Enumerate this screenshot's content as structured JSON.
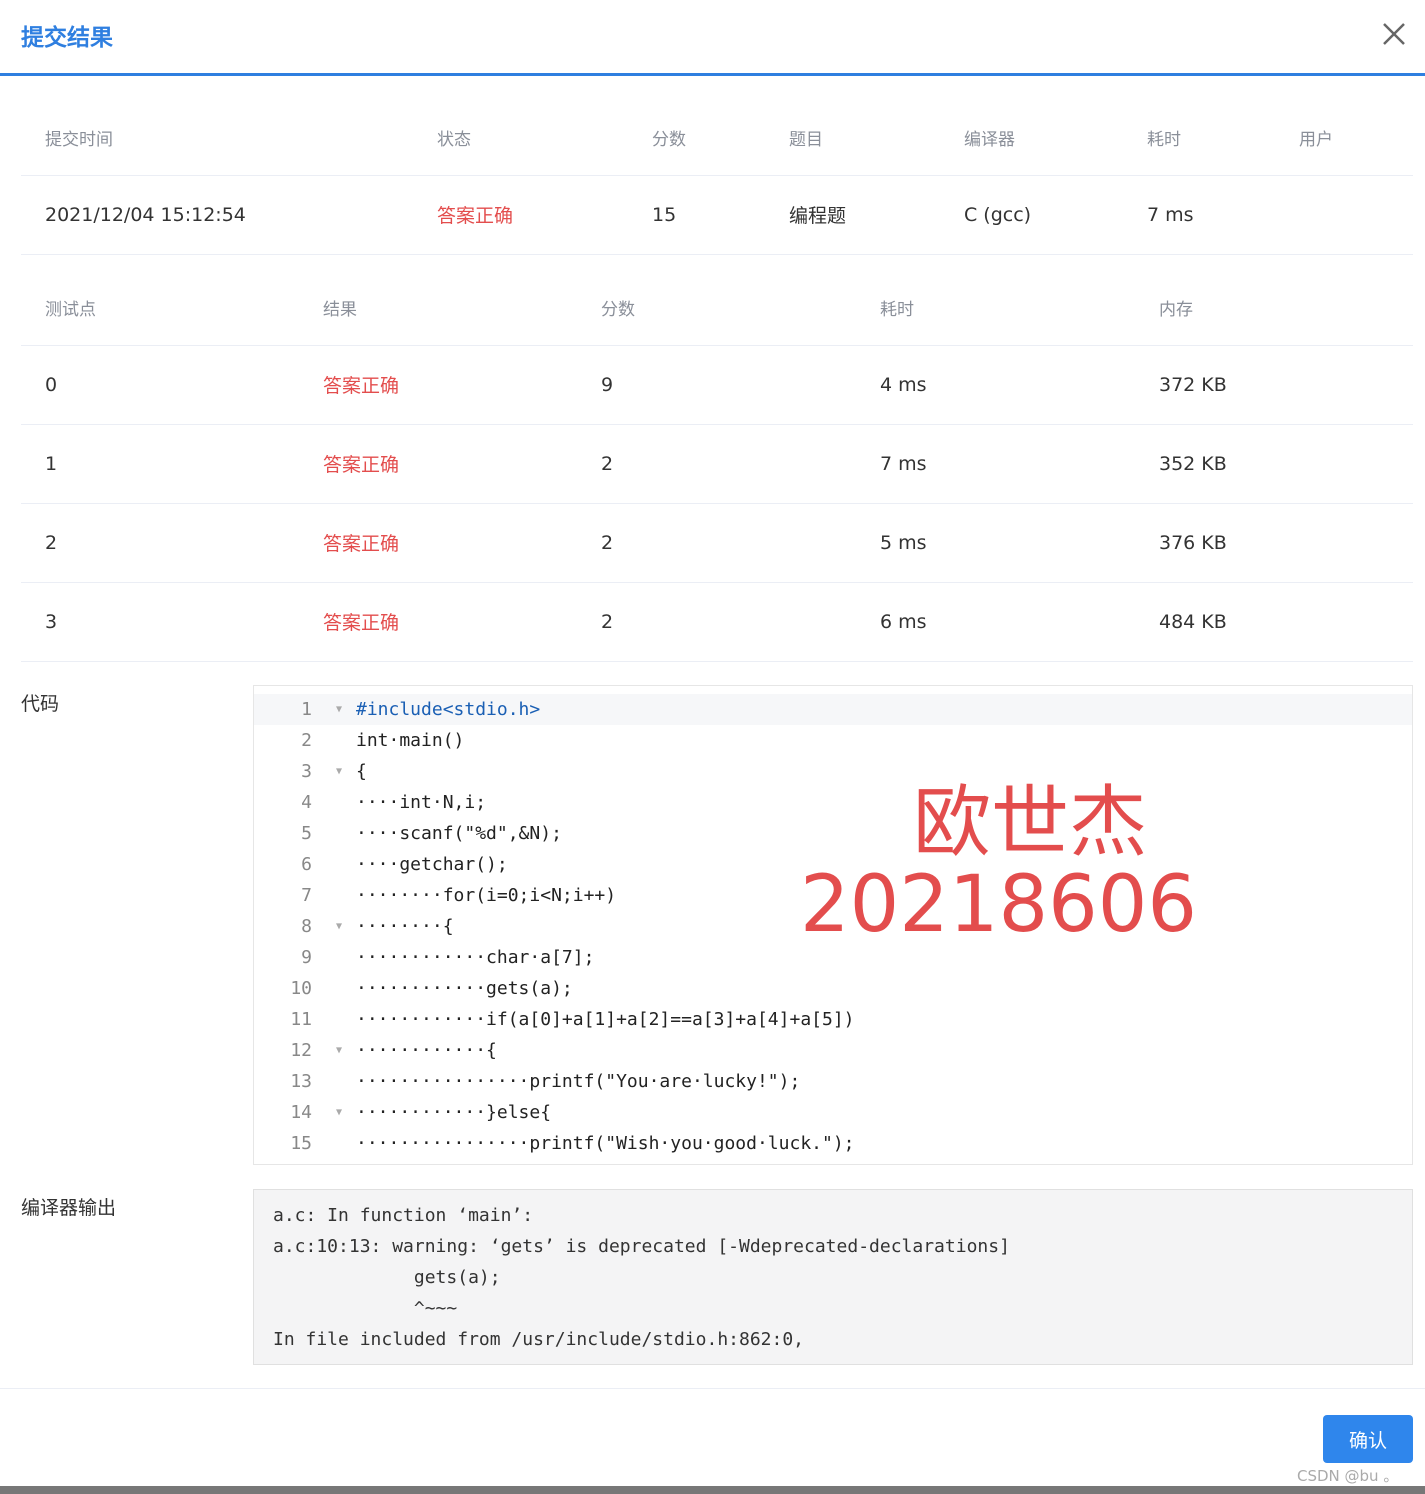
{
  "dialog": {
    "title": "提交结果",
    "confirm_label": "确认"
  },
  "summary": {
    "headers": [
      "提交时间",
      "状态",
      "分数",
      "题目",
      "编译器",
      "耗时",
      "用户"
    ],
    "row": [
      "2021/12/04 15:12:54",
      "答案正确",
      "15",
      "编程题",
      "C (gcc)",
      "7 ms",
      ""
    ]
  },
  "tests": {
    "headers": [
      "测试点",
      "结果",
      "分数",
      "耗时",
      "内存"
    ],
    "rows": [
      [
        "0",
        "答案正确",
        "9",
        "4 ms",
        "372 KB"
      ],
      [
        "1",
        "答案正确",
        "2",
        "7 ms",
        "352 KB"
      ],
      [
        "2",
        "答案正确",
        "2",
        "5 ms",
        "376 KB"
      ],
      [
        "3",
        "答案正确",
        "2",
        "6 ms",
        "484 KB"
      ]
    ]
  },
  "code": {
    "label": "代码",
    "lines": [
      {
        "n": "1",
        "text": "#include<stdio.h>"
      },
      {
        "n": "2",
        "text": "int·main()"
      },
      {
        "n": "3",
        "text": "{"
      },
      {
        "n": "4",
        "text": "····int·N,i;"
      },
      {
        "n": "5",
        "text": "····scanf(\"%d\",&N);"
      },
      {
        "n": "6",
        "text": "····getchar();"
      },
      {
        "n": "7",
        "text": "········for(i=0;i<N;i++)"
      },
      {
        "n": "8",
        "text": "········{"
      },
      {
        "n": "9",
        "text": "············char·a[7];"
      },
      {
        "n": "10",
        "text": "············gets(a);"
      },
      {
        "n": "11",
        "text": "············if(a[0]+a[1]+a[2]==a[3]+a[4]+a[5])"
      },
      {
        "n": "12",
        "text": "············{"
      },
      {
        "n": "13",
        "text": "················printf(\"You·are·lucky!\");"
      },
      {
        "n": "14",
        "text": "············}else{"
      },
      {
        "n": "15",
        "text": "················printf(\"Wish·you·good·luck.\");"
      }
    ]
  },
  "watermark": {
    "name": "欧世杰",
    "id": "20218606"
  },
  "output": {
    "label": "编译器输出",
    "lines": [
      "a.c: In function ‘main’:",
      "a.c:10:13: warning: ‘gets’ is deprecated [-Wdeprecated-declarations]",
      "             gets(a);",
      "             ^~~~",
      "In file included from /usr/include/stdio.h:862:0,"
    ]
  },
  "csdn": "CSDN @bu 。",
  "colors": {
    "accent": "#2f7fe0",
    "success_text": "#e34d4d",
    "button": "#2f86ec"
  },
  "icons": {
    "close": "close-icon",
    "fold": "fold-arrow-icon"
  }
}
